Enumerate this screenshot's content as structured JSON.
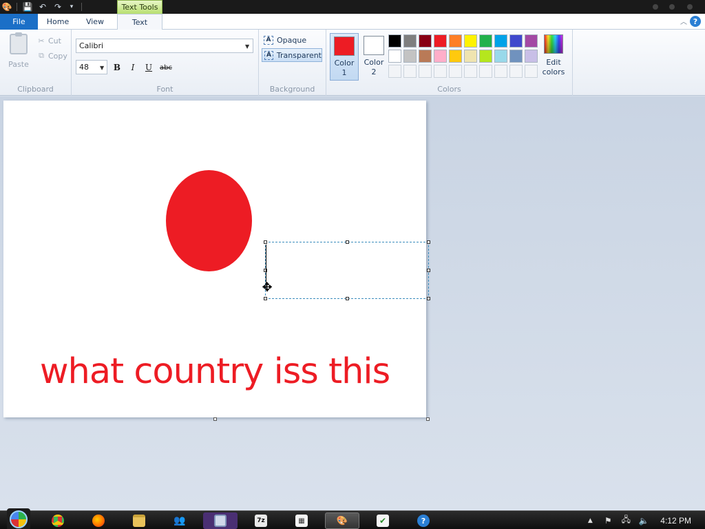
{
  "app": {
    "contextual_tab_title": "Text Tools"
  },
  "tabs": {
    "file": "File",
    "home": "Home",
    "view": "View",
    "text": "Text"
  },
  "clipboard": {
    "paste_label": "Paste",
    "cut_label": "Cut",
    "copy_label": "Copy",
    "group_label": "Clipboard"
  },
  "font": {
    "family": "Calibri",
    "size": "48",
    "bold_label": "B",
    "italic_label": "I",
    "underline_label": "U",
    "strike_label": "abc",
    "group_label": "Font"
  },
  "background": {
    "opaque_label": "Opaque",
    "transparent_label": "Transparent",
    "selected": "Transparent",
    "group_label": "Background"
  },
  "colors": {
    "color1_label_line1": "Color",
    "color1_label_line2": "1",
    "color1_value": "#ed1c24",
    "color2_label_line1": "Color",
    "color2_label_line2": "2",
    "color2_value": "#ffffff",
    "edit_label_line1": "Edit",
    "edit_label_line2": "colors",
    "group_label": "Colors",
    "palette": [
      "#000000",
      "#7f7f7f",
      "#880015",
      "#ed1c24",
      "#ff7f27",
      "#fff200",
      "#22b14c",
      "#00a2e8",
      "#3f48cc",
      "#a349a4",
      "#ffffff",
      "#c3c3c3",
      "#b97a57",
      "#ffaec9",
      "#ffc90e",
      "#efe4b0",
      "#b5e61d",
      "#99d9ea",
      "#7092be",
      "#c8bfe7",
      "",
      "",
      "",
      "",
      "",
      "",
      "",
      "",
      "",
      ""
    ]
  },
  "canvas": {
    "caption": "what country iss this",
    "circle_color": "#ed1c24",
    "text_color": "#ed1c24"
  },
  "taskbar": {
    "apps": [
      "chrome",
      "firefox",
      "file-explorer",
      "network",
      "remote-desktop",
      "7zip",
      "task-manager",
      "paint",
      "notepad-task",
      "help"
    ],
    "active_app": "paint",
    "clock": "4:12 PM"
  }
}
